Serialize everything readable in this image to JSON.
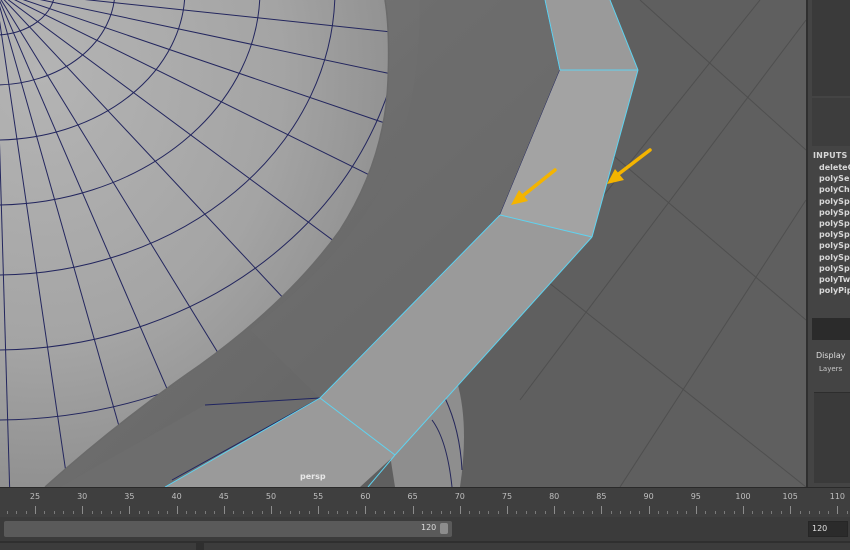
{
  "viewport": {
    "camera_label": "persp",
    "edge_highlight_color": "#5fd3f0",
    "annotation_arrow_color": "#f4b400",
    "icons": [
      "arrow-left-down-icon",
      "arrow-left-down-icon"
    ]
  },
  "sidebar": {
    "inputs_title": "INPUTS",
    "inputs": [
      "deleteCo",
      "polySep",
      "polyChip",
      "polySpli",
      "polySpli",
      "polySpli",
      "polySpli",
      "polySpli",
      "polySpli",
      "polySpli",
      "polyTwe",
      "polyPipe"
    ],
    "display_label": "Display",
    "layers_label": "Layers"
  },
  "timeline": {
    "ticks": [
      "25",
      "30",
      "35",
      "40",
      "45",
      "50",
      "55",
      "60",
      "65",
      "70",
      "75",
      "80",
      "85",
      "90",
      "95",
      "100",
      "105",
      "110"
    ]
  },
  "range": {
    "end_value": "120",
    "end_field_value": "120"
  }
}
